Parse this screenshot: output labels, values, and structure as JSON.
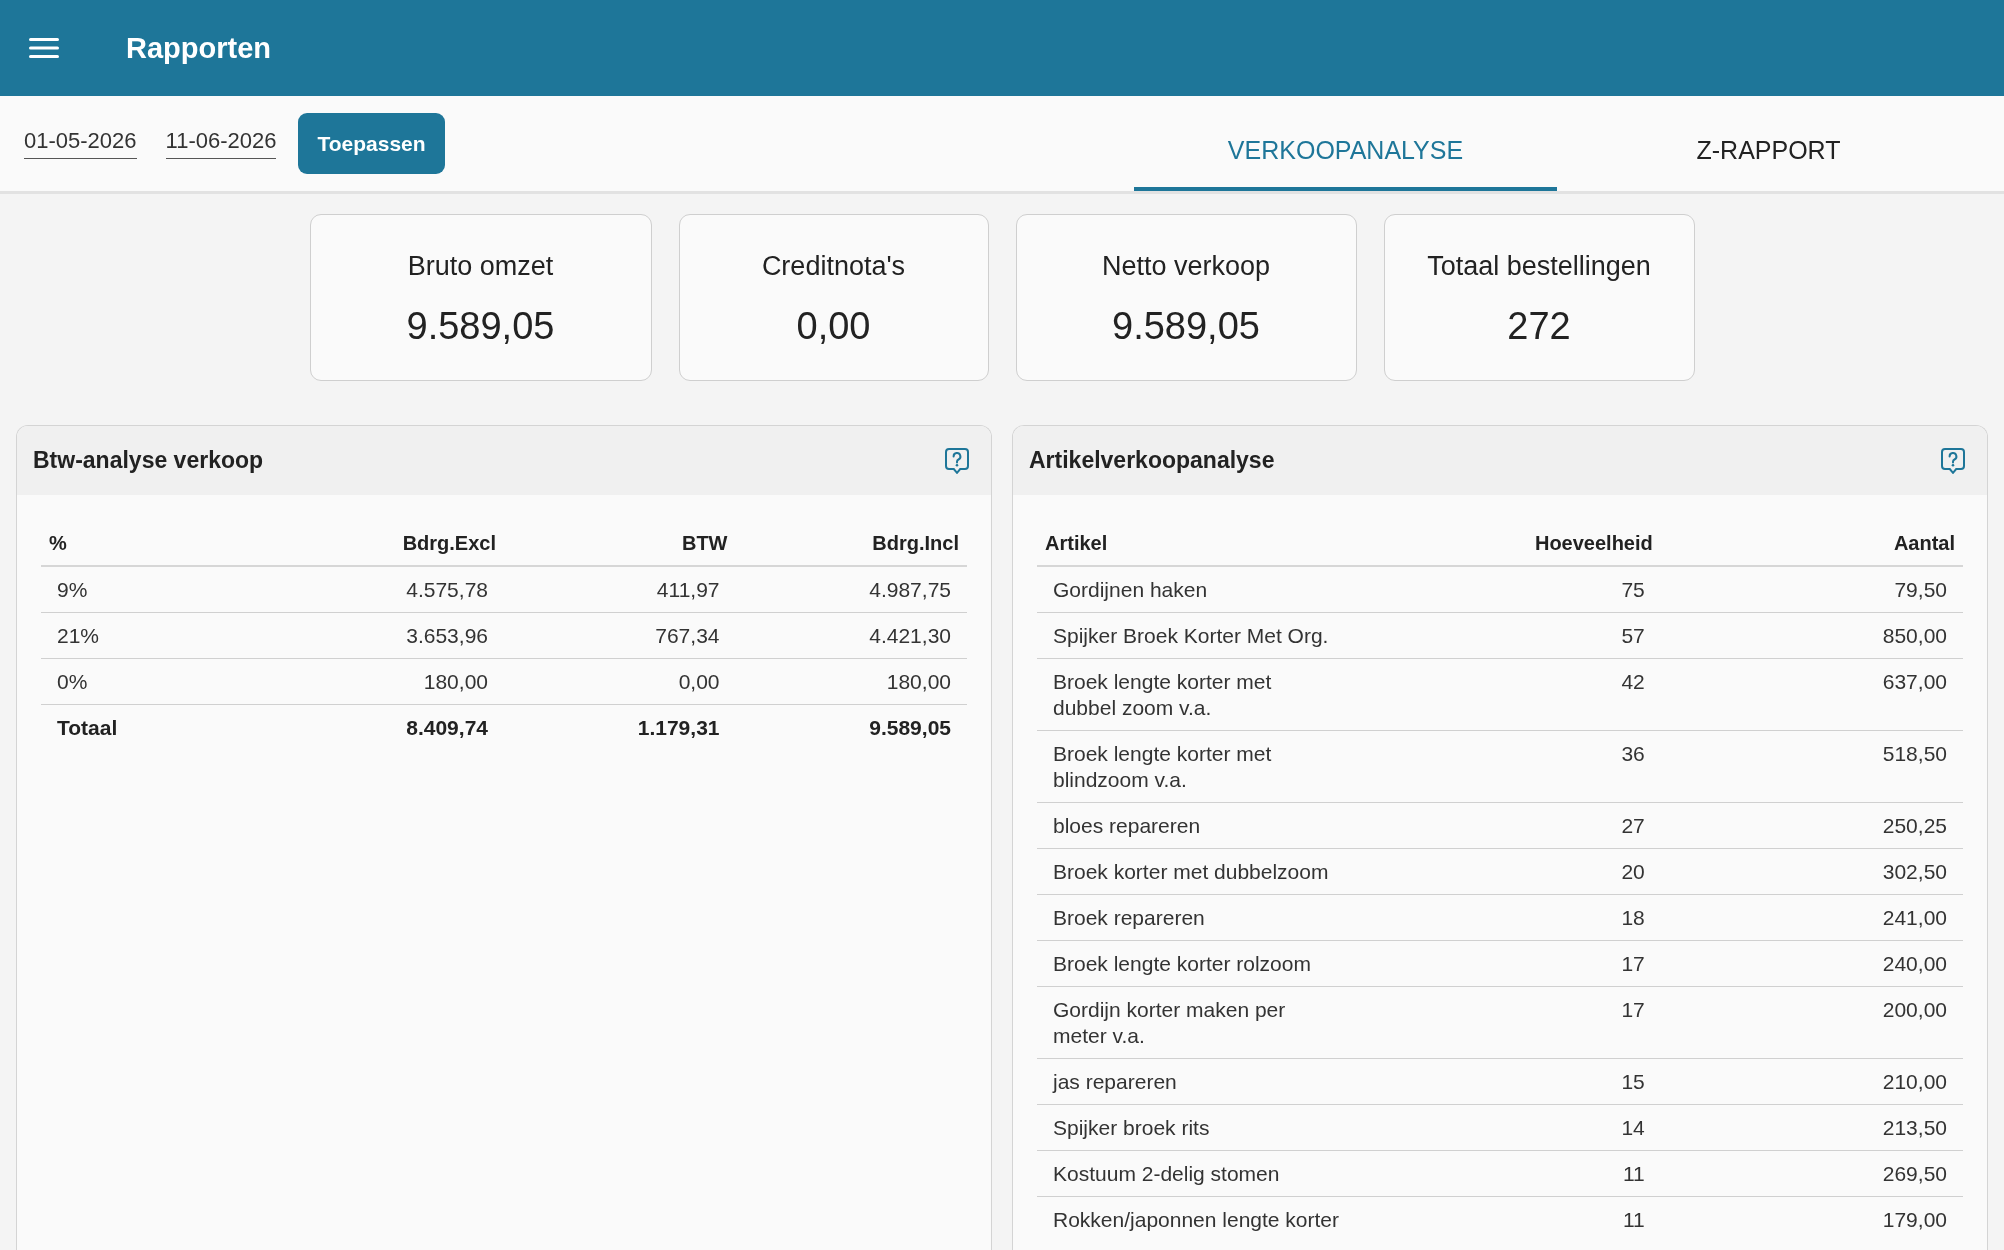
{
  "app_bar": {
    "title": "Rapporten"
  },
  "filters": {
    "date_from": "01-05-2026",
    "date_to": "11-06-2026",
    "apply_button": "Toepassen"
  },
  "tabs": [
    {
      "label": "VERKOOPANALYSE",
      "selected": true
    },
    {
      "label": "Z-RAPPORT",
      "selected": false
    }
  ],
  "kpi_cards": [
    {
      "label": "Bruto omzet",
      "value": "9.589,05"
    },
    {
      "label": "Creditnota's",
      "value": "0,00"
    },
    {
      "label": "Netto verkoop",
      "value": "9.589,05"
    },
    {
      "label": "Totaal bestellingen",
      "value": "272"
    }
  ],
  "vat_panel": {
    "title": "Btw-analyse verkoop",
    "columns": [
      "%",
      "Bdrg.Excl",
      "BTW",
      "Bdrg.Incl"
    ],
    "rows": [
      {
        "cells": [
          "9%",
          "4.575,78",
          "411,97",
          "4.987,75"
        ],
        "total": false
      },
      {
        "cells": [
          "21%",
          "3.653,96",
          "767,34",
          "4.421,30"
        ],
        "total": false
      },
      {
        "cells": [
          "0%",
          "180,00",
          "0,00",
          "180,00"
        ],
        "total": false
      },
      {
        "cells": [
          "Totaal",
          "8.409,74",
          "1.179,31",
          "9.589,05"
        ],
        "total": true
      }
    ]
  },
  "article_panel": {
    "title": "Artikelverkoopanalyse",
    "columns": [
      "Artikel",
      "Hoeveelheid",
      "Aantal"
    ],
    "rows": [
      [
        "Gordijnen haken",
        "75",
        "79,50"
      ],
      [
        "Spijker Broek Korter Met Org.",
        "57",
        "850,00"
      ],
      [
        "Broek lengte korter met\ndubbel zoom v.a.",
        "42",
        "637,00"
      ],
      [
        "Broek lengte korter met\nblindzoom v.a.",
        "36",
        "518,50"
      ],
      [
        "bloes repareren",
        "27",
        "250,25"
      ],
      [
        "Broek korter met dubbelzoom",
        "20",
        "302,50"
      ],
      [
        "Broek repareren",
        "18",
        "241,00"
      ],
      [
        "Broek lengte korter rolzoom",
        "17",
        "240,00"
      ],
      [
        "Gordijn korter maken per\nmeter v.a.",
        "17",
        "200,00"
      ],
      [
        "jas repareren",
        "15",
        "210,00"
      ],
      [
        "Spijker broek rits",
        "14",
        "213,50"
      ],
      [
        "Kostuum 2-delig stomen",
        "11",
        "269,50"
      ],
      [
        "Rokken/japonnen lengte korter",
        "11",
        "179,00"
      ]
    ]
  }
}
